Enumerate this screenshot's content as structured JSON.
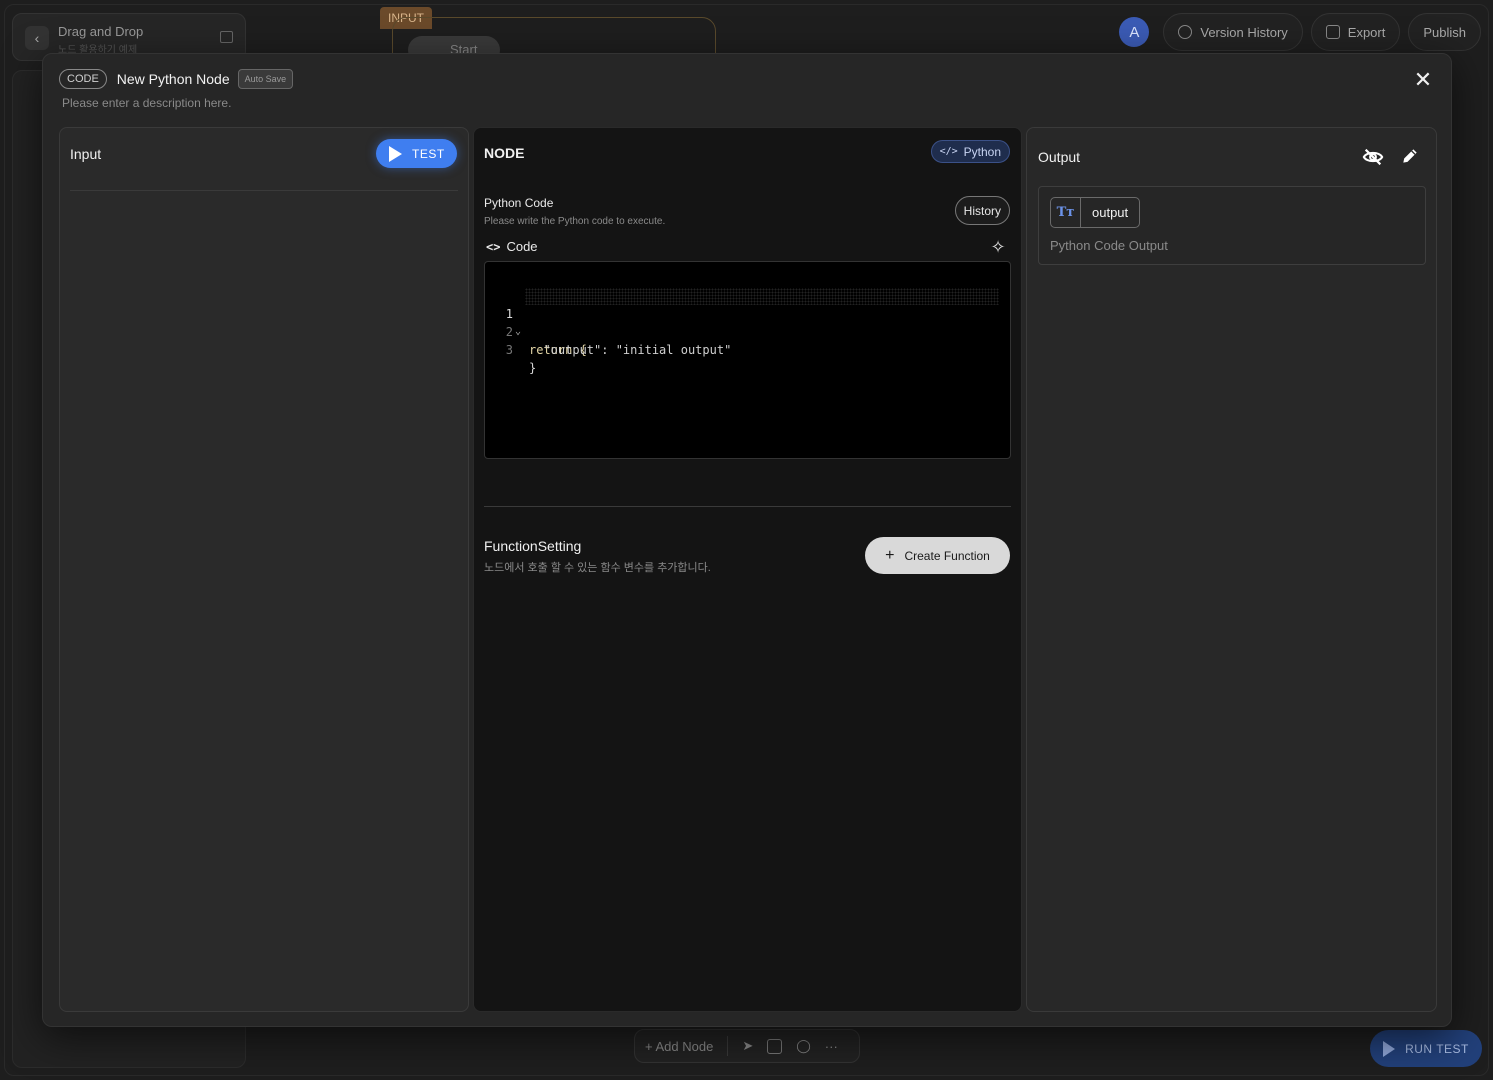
{
  "background": {
    "project_title": "Drag and Drop",
    "project_subtitle": "노드 활용하기 예제",
    "canvas_tag": "INPUT",
    "start_node_label": "Start",
    "avatar_initial": "A",
    "version_history_label": "Version History",
    "export_label": "Export",
    "publish_label": "Publish",
    "add_node_label": "+ Add Node",
    "run_test_label": "RUN TEST"
  },
  "modal": {
    "type_badge": "CODE",
    "title": "New Python Node",
    "autosave_badge": "Auto Save",
    "description": "Please enter a description here.",
    "close_icon": "close-icon"
  },
  "input_panel": {
    "label": "Input",
    "test_button": "TEST"
  },
  "node_panel": {
    "label": "NODE",
    "language_badge": "Python",
    "section_title": "Python Code",
    "section_subtitle": "Please write the Python code to execute.",
    "history_button": "History",
    "code_label": "Code",
    "code_lines": [
      {
        "n": "1",
        "text": "return {"
      },
      {
        "n": "2",
        "text": "  \"output\": \"initial output\""
      },
      {
        "n": "3",
        "text": "}"
      }
    ],
    "function_setting_title": "FunctionSetting",
    "function_setting_subtitle": "노드에서 호출 할 수 있는 함수 변수를 추가합니다.",
    "create_function_button": "Create Function"
  },
  "output_panel": {
    "label": "Output",
    "output_type_icon": "Tт",
    "output_name": "output",
    "output_description": "Python Code Output"
  },
  "colors": {
    "accent_blue": "#3f7ef0",
    "python_badge_bg": "#1f2d4d",
    "modal_bg": "#262626",
    "editor_bg": "#000000"
  }
}
